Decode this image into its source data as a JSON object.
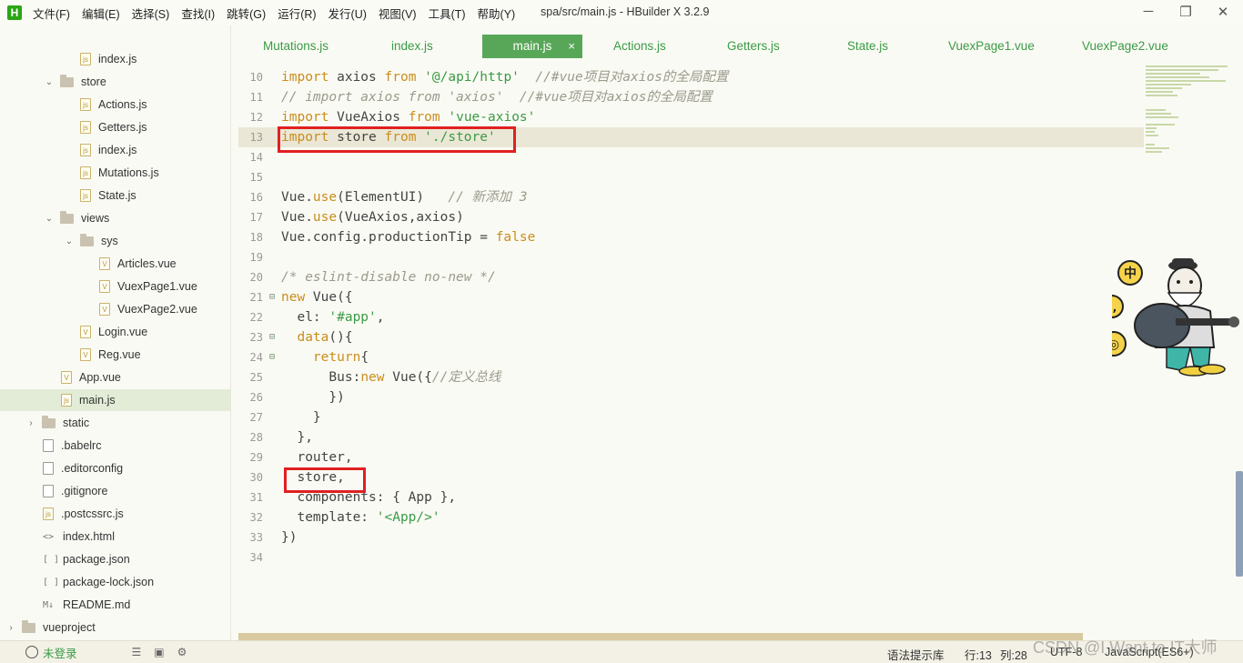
{
  "titlebar": {
    "logo": "H",
    "menu": [
      "文件(F)",
      "编辑(E)",
      "选择(S)",
      "查找(I)",
      "跳转(G)",
      "运行(R)",
      "发行(U)",
      "视图(V)",
      "工具(T)",
      "帮助(Y)"
    ],
    "title": "spa/src/main.js - HBuilder X 3.2.9",
    "minimize": "─",
    "maximize": "❐",
    "close": "✕"
  },
  "sidebar": {
    "items": [
      {
        "label": "index.js"
      },
      {
        "label": "store"
      },
      {
        "label": "Actions.js"
      },
      {
        "label": "Getters.js"
      },
      {
        "label": "index.js"
      },
      {
        "label": "Mutations.js"
      },
      {
        "label": "State.js"
      },
      {
        "label": "views"
      },
      {
        "label": "sys"
      },
      {
        "label": "Articles.vue"
      },
      {
        "label": "VuexPage1.vue"
      },
      {
        "label": "VuexPage2.vue"
      },
      {
        "label": "Login.vue"
      },
      {
        "label": "Reg.vue"
      },
      {
        "label": "App.vue"
      },
      {
        "label": "main.js"
      },
      {
        "label": "static"
      },
      {
        "label": ".babelrc"
      },
      {
        "label": ".editorconfig"
      },
      {
        "label": ".gitignore"
      },
      {
        "label": ".postcssrc.js"
      },
      {
        "label": "index.html"
      },
      {
        "label": "package.json"
      },
      {
        "label": "package-lock.json"
      },
      {
        "label": "README.md"
      },
      {
        "label": "vueproject"
      }
    ]
  },
  "tabs": [
    {
      "label": "Mutations.js"
    },
    {
      "label": "index.js"
    },
    {
      "label": "main.js"
    },
    {
      "label": "Actions.js"
    },
    {
      "label": "Getters.js"
    },
    {
      "label": "State.js"
    },
    {
      "label": "VuexPage1.vue"
    },
    {
      "label": "VuexPage2.vue"
    }
  ],
  "tab_close": "×",
  "editor": {
    "lines": [
      {
        "n": "10",
        "code": "import axios from '@/api/http'  //#vue项目对axios的全局配置"
      },
      {
        "n": "11",
        "code": "// import axios from 'axios'  //#vue项目对axios的全局配置"
      },
      {
        "n": "12",
        "code": "import VueAxios from 'vue-axios'"
      },
      {
        "n": "13",
        "code": "import store from './store'"
      },
      {
        "n": "14",
        "code": ""
      },
      {
        "n": "15",
        "code": ""
      },
      {
        "n": "16",
        "code": "Vue.use(ElementUI)   // 新添加 3"
      },
      {
        "n": "17",
        "code": "Vue.use(VueAxios,axios)"
      },
      {
        "n": "18",
        "code": "Vue.config.productionTip = false"
      },
      {
        "n": "19",
        "code": ""
      },
      {
        "n": "20",
        "code": "/* eslint-disable no-new */"
      },
      {
        "n": "21",
        "code": "new Vue({"
      },
      {
        "n": "22",
        "code": "  el: '#app',"
      },
      {
        "n": "23",
        "code": "  data(){"
      },
      {
        "n": "24",
        "code": "    return{"
      },
      {
        "n": "25",
        "code": "      Bus:new Vue({//定义总线"
      },
      {
        "n": "26",
        "code": "      })"
      },
      {
        "n": "27",
        "code": "    }"
      },
      {
        "n": "28",
        "code": "  },"
      },
      {
        "n": "29",
        "code": "  router,"
      },
      {
        "n": "30",
        "code": "  store,"
      },
      {
        "n": "31",
        "code": "  components: { App },"
      },
      {
        "n": "32",
        "code": "  template: '<App/>'"
      },
      {
        "n": "33",
        "code": "})"
      },
      {
        "n": "34",
        "code": ""
      }
    ],
    "fold_marker": "⊟"
  },
  "mascot": {
    "bubble1": "中",
    "bubble2": "°,",
    "bubble3": "◎"
  },
  "statusbar": {
    "login": "未登录",
    "syntax_lib": "语法提示库",
    "row": "行:13",
    "col": "列:28",
    "encoding": "UTF-8",
    "language": "JavaScript(ES6+)"
  },
  "watermark": "CSDN @I Want to IT大师",
  "colors": {
    "accent_green": "#58a758",
    "keyword": "#c98d1c",
    "string": "#3a9b45",
    "highlight_red": "#e02020"
  }
}
